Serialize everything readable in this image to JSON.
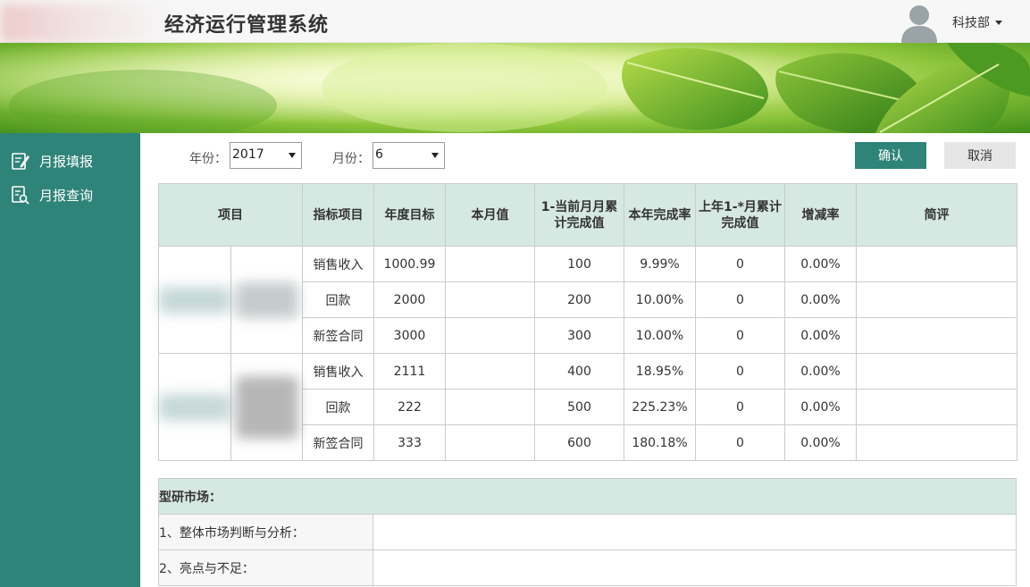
{
  "header": {
    "app_title": "经济运行管理系统",
    "user_name": "科技部"
  },
  "sidebar": {
    "items": [
      {
        "label": "月报填报",
        "icon": "edit-icon"
      },
      {
        "label": "月报查询",
        "icon": "search-doc-icon"
      }
    ]
  },
  "filters": {
    "year_label": "年份：",
    "year_value": "2017",
    "month_label": "月份：",
    "month_value": "6",
    "confirm_label": "确认",
    "cancel_label": "取消"
  },
  "table": {
    "headers": [
      "项目",
      "指标项目",
      "年度目标",
      "本月值",
      "1-当前月月累计完成值",
      "本年完成率",
      "上年1-*月累计完成值",
      "增减率",
      "简评"
    ],
    "rows": [
      {
        "indicator": "销售收入",
        "target": "1000.99",
        "month": "",
        "cumulative": "100",
        "rate": "9.99%",
        "last_year": "0",
        "change": "0.00%",
        "comment": ""
      },
      {
        "indicator": "回款",
        "target": "2000",
        "month": "",
        "cumulative": "200",
        "rate": "10.00%",
        "last_year": "0",
        "change": "0.00%",
        "comment": ""
      },
      {
        "indicator": "新签合同",
        "target": "3000",
        "month": "",
        "cumulative": "300",
        "rate": "10.00%",
        "last_year": "0",
        "change": "0.00%",
        "comment": ""
      },
      {
        "indicator": "销售收入",
        "target": "2111",
        "month": "",
        "cumulative": "400",
        "rate": "18.95%",
        "last_year": "0",
        "change": "0.00%",
        "comment": ""
      },
      {
        "indicator": "回款",
        "target": "222",
        "month": "",
        "cumulative": "500",
        "rate": "225.23%",
        "last_year": "0",
        "change": "0.00%",
        "comment": ""
      },
      {
        "indicator": "新签合同",
        "target": "333",
        "month": "",
        "cumulative": "600",
        "rate": "180.18%",
        "last_year": "0",
        "change": "0.00%",
        "comment": ""
      }
    ]
  },
  "section": {
    "title": "型研市场：",
    "items": [
      "1、整体市场判断与分析：",
      "2、亮点与不足："
    ]
  },
  "colors": {
    "sidebar_bg": "#2f8479",
    "header_cell_bg": "#d6e8e2",
    "confirm_bg": "#2f8479"
  }
}
